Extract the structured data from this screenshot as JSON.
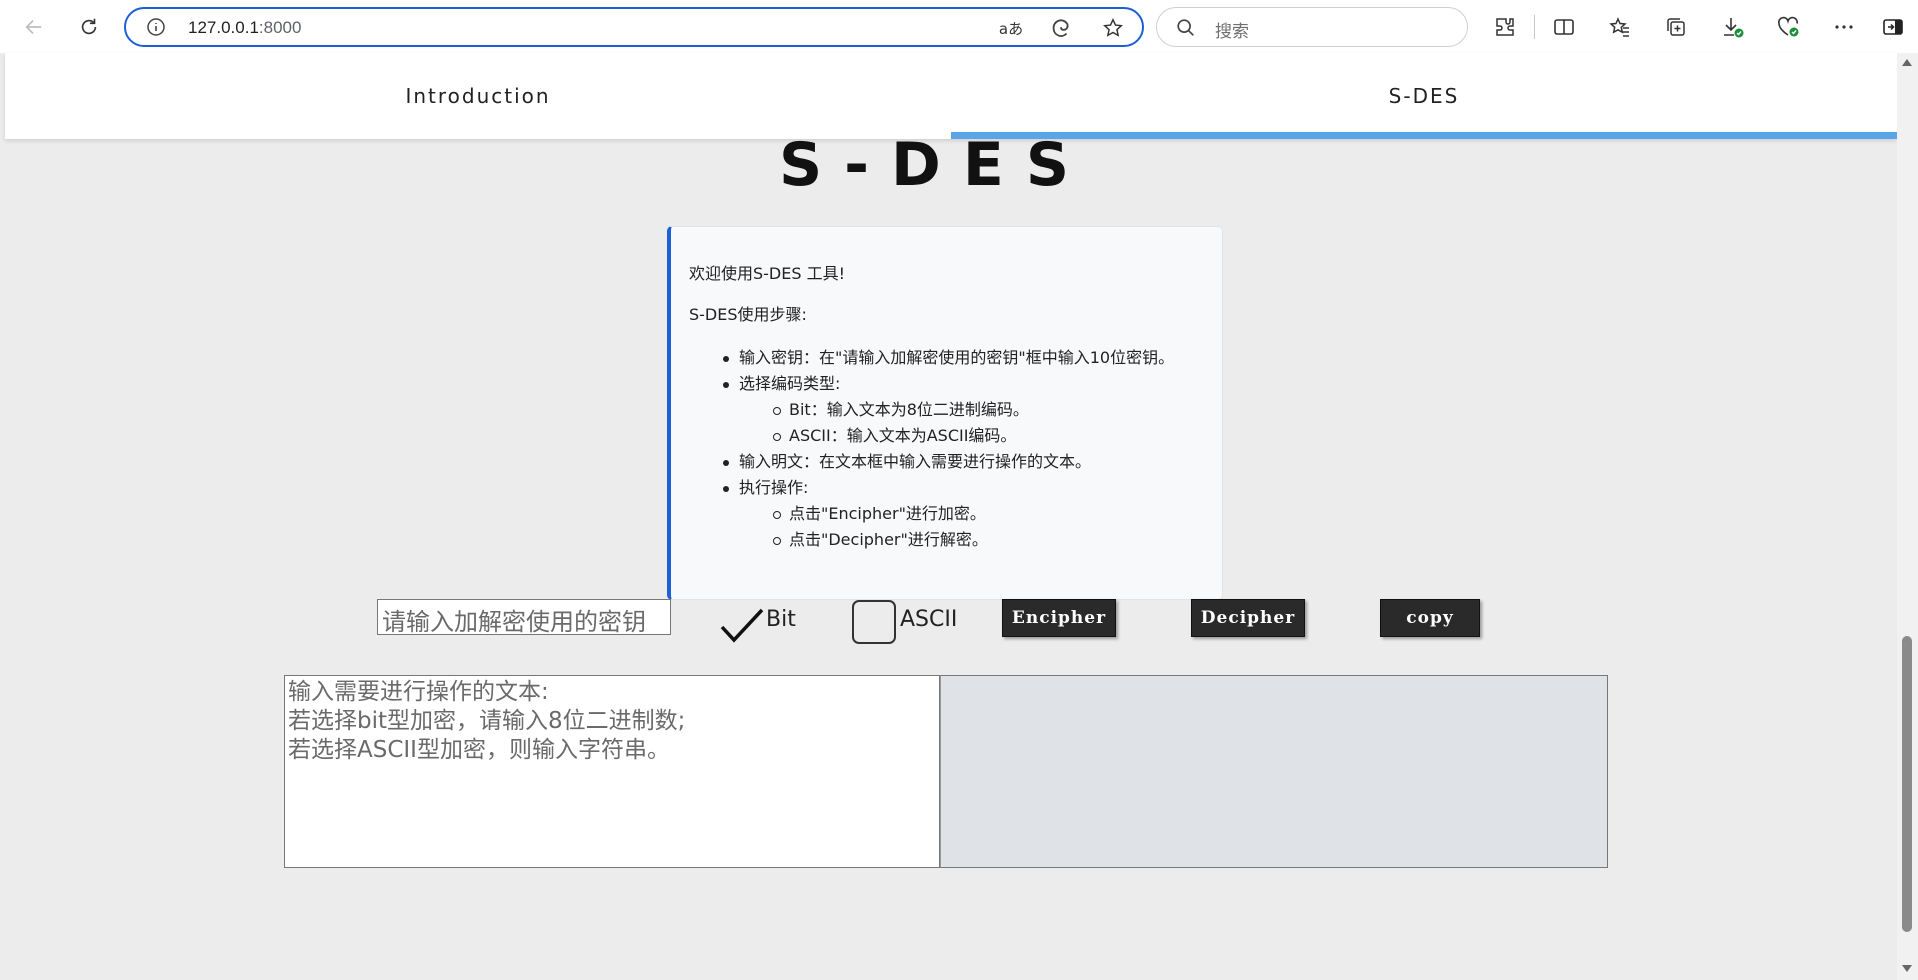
{
  "browser": {
    "url_host": "127.0.0.1",
    "url_port": ":8000",
    "search_placeholder": "搜索",
    "read_aloud_glyph": "aあ"
  },
  "tabs": [
    {
      "label": "Introduction",
      "active": false
    },
    {
      "label": "S-DES",
      "active": true
    }
  ],
  "accent_color": "#5aa5e8",
  "card_border_color": "#1c5fd6",
  "page_title": "S-DES",
  "info": {
    "welcome": "欢迎使用S-DES 工具!",
    "steps_title": "S-DES使用步骤:",
    "step1": "输入密钥：在\"请输入加解密使用的密钥\"框中输入10位密钥。",
    "step2": "选择编码类型:",
    "step2_sub1": "Bit：输入文本为8位二进制编码。",
    "step2_sub2": "ASCII：输入文本为ASCII编码。",
    "step3": "输入明文：在文本框中输入需要进行操作的文本。",
    "step4": "执行操作:",
    "step4_sub1": "点击\"Encipher\"进行加密。",
    "step4_sub2": "点击\"Decipher\"进行解密。"
  },
  "controls": {
    "key_placeholder": "请输入加解密使用的密钥",
    "bit_label": "Bit",
    "bit_checked": true,
    "ascii_label": "ASCII",
    "ascii_checked": false,
    "encipher_label": "Encipher",
    "decipher_label": "Decipher",
    "copy_label": "copy",
    "text_placeholder": "输入需要进行操作的文本:\n若选择bit型加密，请输入8位二进制数;\n若选择ASCII型加密，则输入字符串。",
    "output_value": ""
  }
}
